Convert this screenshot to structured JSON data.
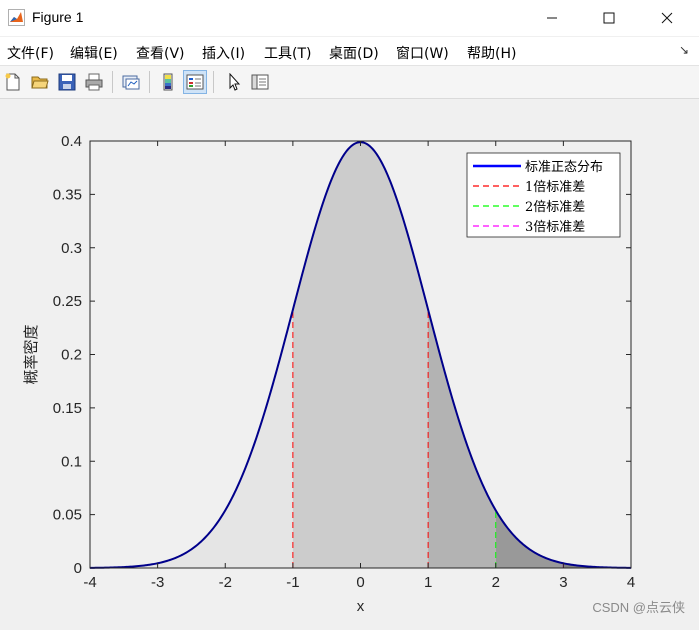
{
  "window": {
    "title": "Figure 1",
    "minimize_glyph": "—",
    "maximize_glyph": "☐",
    "close_glyph": "✕"
  },
  "menu": {
    "items": [
      "文件(F)",
      "编辑(E)",
      "查看(V)",
      "插入(I)",
      "工具(T)",
      "桌面(D)",
      "窗口(W)",
      "帮助(H)"
    ],
    "overflow_glyph": "↘"
  },
  "toolbar": {
    "buttons": [
      {
        "name": "new-figure-icon",
        "active": false
      },
      {
        "name": "open-file-icon",
        "active": false
      },
      {
        "name": "save-icon",
        "active": false
      },
      {
        "name": "print-icon",
        "active": false
      },
      {
        "name": "link-plot-icon",
        "active": false
      },
      {
        "name": "colorbar-icon",
        "active": false
      },
      {
        "name": "legend-icon",
        "active": true
      },
      {
        "name": "pointer-icon",
        "active": false
      },
      {
        "name": "property-inspector-icon",
        "active": false
      }
    ]
  },
  "watermark": "CSDN @点云侠",
  "colors": {
    "pdf_line": "#00008b",
    "sigma1": "#ff0000",
    "sigma2": "#00ff00",
    "sigma3": "#ff00ff",
    "legend_pdf": "#0000ff"
  },
  "chart_data": {
    "type": "area",
    "title": "",
    "xlabel": "x",
    "ylabel": "概率密度",
    "xlim": [
      -4,
      4
    ],
    "ylim": [
      0,
      0.4
    ],
    "xticks": [
      -4,
      -3,
      -2,
      -1,
      0,
      1,
      2,
      3,
      4
    ],
    "yticks": [
      0,
      0.05,
      0.1,
      0.15,
      0.2,
      0.25,
      0.3,
      0.35,
      0.4
    ],
    "xtick_labels": [
      "-4",
      "-3",
      "-2",
      "-1",
      "0",
      "1",
      "2",
      "3",
      "4"
    ],
    "ytick_labels": [
      "0",
      "0.05",
      "0.1",
      "0.15",
      "0.2",
      "0.25",
      "0.3",
      "0.35",
      "0.4"
    ],
    "grid": false,
    "legend_position": "top-right",
    "series": [
      {
        "name": "标准正态分布",
        "style": "solid",
        "x": [
          -4,
          -3.8,
          -3.6,
          -3.4,
          -3.2,
          -3,
          -2.8,
          -2.6,
          -2.4,
          -2.2,
          -2,
          -1.8,
          -1.6,
          -1.4,
          -1.2,
          -1,
          -0.8,
          -0.6,
          -0.4,
          -0.2,
          0,
          0.2,
          0.4,
          0.6,
          0.8,
          1,
          1.2,
          1.4,
          1.6,
          1.8,
          2,
          2.2,
          2.4,
          2.6,
          2.8,
          3,
          3.2,
          3.4,
          3.6,
          3.8,
          4
        ],
        "y": [
          0.0001,
          0.0003,
          0.0006,
          0.0012,
          0.0024,
          0.0044,
          0.0079,
          0.0136,
          0.0224,
          0.0355,
          0.054,
          0.079,
          0.1109,
          0.1497,
          0.1942,
          0.242,
          0.2897,
          0.3332,
          0.3683,
          0.391,
          0.3989,
          0.391,
          0.3683,
          0.3332,
          0.2897,
          0.242,
          0.1942,
          0.1497,
          0.1109,
          0.079,
          0.054,
          0.0355,
          0.0224,
          0.0136,
          0.0079,
          0.0044,
          0.0024,
          0.0012,
          0.0006,
          0.0003,
          0.0001
        ]
      },
      {
        "name": "1倍标准差",
        "style": "dashed",
        "x": [
          -1,
          1
        ],
        "y": [
          0.242,
          0.242
        ]
      },
      {
        "name": "2倍标准差",
        "style": "dashed",
        "x": [
          2
        ],
        "y": [
          0.054
        ]
      },
      {
        "name": "3倍标准差",
        "style": "dashed",
        "x": [
          3
        ],
        "y": [
          0.0044
        ]
      }
    ],
    "shaded_regions": [
      {
        "from": -4,
        "to": 4,
        "gray": "#e5e5e5"
      },
      {
        "from": -1,
        "to": 1,
        "gray": "#cccccc"
      },
      {
        "from": 1,
        "to": 2,
        "gray": "#b3b3b3"
      },
      {
        "from": 2,
        "to": 3,
        "gray": "#999999"
      },
      {
        "from": 3,
        "to": 4,
        "gray": "#808080"
      }
    ]
  }
}
